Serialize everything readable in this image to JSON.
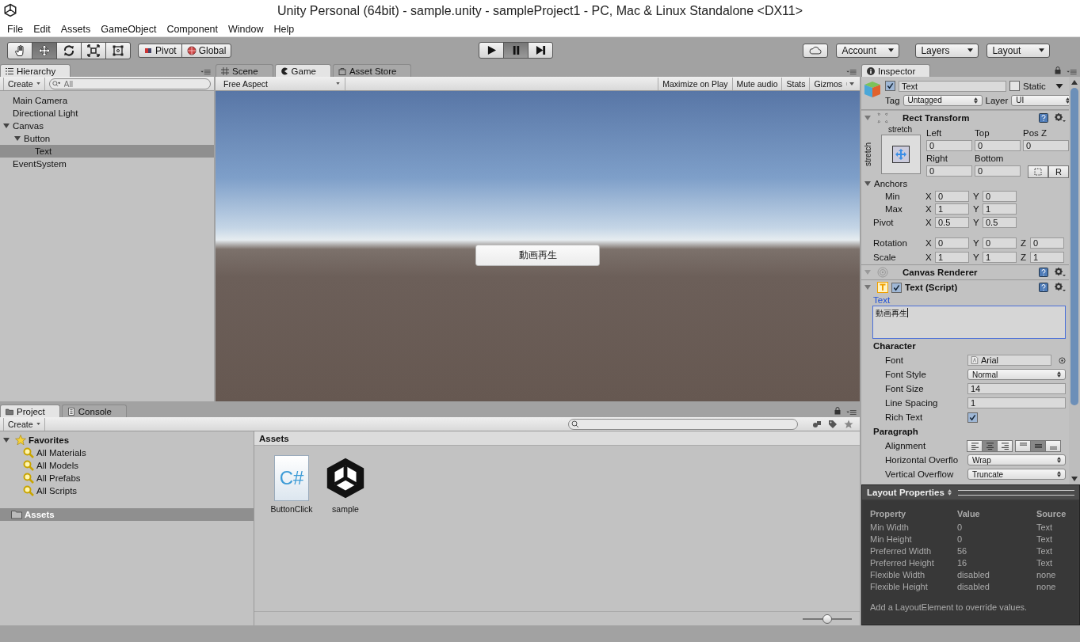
{
  "window": {
    "title": "Unity Personal (64bit) - sample.unity - sampleProject1 - PC, Mac & Linux Standalone <DX11>"
  },
  "menu": [
    "File",
    "Edit",
    "Assets",
    "GameObject",
    "Component",
    "Window",
    "Help"
  ],
  "toolbar": {
    "tools": [
      {
        "kind": "hand",
        "selected": false
      },
      {
        "kind": "move",
        "selected": true
      },
      {
        "kind": "rotate",
        "selected": false
      },
      {
        "kind": "scale",
        "selected": false
      },
      {
        "kind": "rect",
        "selected": false
      }
    ],
    "pivot": "Pivot",
    "global": "Global",
    "playback": [
      {
        "kind": "play",
        "selected": false
      },
      {
        "kind": "pause",
        "selected": true
      },
      {
        "kind": "step",
        "selected": false
      }
    ],
    "account": "Account",
    "layers": "Layers",
    "layout": "Layout"
  },
  "hierarchy": {
    "tab": "Hierarchy",
    "create": "Create",
    "search": {
      "placeholder": "All"
    },
    "items": [
      {
        "label": "Main Camera",
        "selected": false
      },
      {
        "label": "Directional Light",
        "selected": false
      },
      {
        "label": "Canvas",
        "selected": false,
        "expanded": true,
        "children": [
          {
            "label": "Button",
            "selected": false,
            "expanded": true,
            "children": [
              {
                "label": "Text",
                "selected": true
              }
            ]
          }
        ]
      },
      {
        "label": "EventSystem",
        "selected": false
      }
    ]
  },
  "view": {
    "tabs": [
      {
        "kind": "scene",
        "label": "Scene",
        "selected": false
      },
      {
        "kind": "game",
        "label": "Game",
        "selected": true
      },
      {
        "kind": "store",
        "label": "Asset Store",
        "selected": false
      }
    ],
    "aspect": "Free Aspect",
    "options": [
      "Maximize on Play",
      "Mute audio",
      "Stats",
      "Gizmos"
    ],
    "game_button": "動画再生"
  },
  "project": {
    "tabs": [
      {
        "kind": "project",
        "label": "Project",
        "selected": true
      },
      {
        "kind": "console",
        "label": "Console",
        "selected": false
      }
    ],
    "create": "Create",
    "favorites": {
      "label": "Favorites",
      "expanded": true,
      "items": [
        "All Materials",
        "All Models",
        "All Prefabs",
        "All Scripts"
      ]
    },
    "folders": [
      {
        "label": "Assets",
        "selected": true
      }
    ],
    "breadcrumb": "Assets",
    "assets": [
      {
        "kind": "script",
        "name": "ButtonClick",
        "badge": "C#"
      },
      {
        "kind": "scene",
        "name": "sample"
      }
    ],
    "zoom": {
      "level": 0.5
    }
  },
  "inspector": {
    "tab": "Inspector",
    "object": {
      "active": true,
      "name": "Text",
      "static": false,
      "static_label": "Static",
      "tag_label": "Tag",
      "tag": "Untagged",
      "layer_label": "Layer",
      "layer": "UI"
    },
    "rect_transform": {
      "title": "Rect Transform",
      "preset_h": "stretch",
      "preset_v": "stretch",
      "fields": [
        {
          "label": "Left",
          "value": "0"
        },
        {
          "label": "Top",
          "value": "0"
        },
        {
          "label": "Pos Z",
          "value": "0"
        },
        {
          "label": "Right",
          "value": "0"
        },
        {
          "label": "Bottom",
          "value": "0"
        }
      ],
      "reset": "R",
      "anchors": {
        "label": "Anchors",
        "rows": [
          {
            "label": "Min",
            "components": [
              {
                "axis": "X",
                "value": "0"
              },
              {
                "axis": "Y",
                "value": "0"
              }
            ]
          },
          {
            "label": "Max",
            "components": [
              {
                "axis": "X",
                "value": "1"
              },
              {
                "axis": "Y",
                "value": "1"
              }
            ]
          }
        ]
      },
      "pivot": {
        "label": "Pivot",
        "components": [
          {
            "axis": "X",
            "value": "0.5"
          },
          {
            "axis": "Y",
            "value": "0.5"
          }
        ]
      },
      "vectors": [
        {
          "label": "Rotation",
          "components": [
            {
              "axis": "X",
              "value": "0"
            },
            {
              "axis": "Y",
              "value": "0"
            },
            {
              "axis": "Z",
              "value": "0"
            }
          ]
        },
        {
          "label": "Scale",
          "components": [
            {
              "axis": "X",
              "value": "1"
            },
            {
              "axis": "Y",
              "value": "1"
            },
            {
              "axis": "Z",
              "value": "1"
            }
          ]
        }
      ]
    },
    "canvas_renderer": {
      "title": "Canvas Renderer"
    },
    "text_component": {
      "title": "Text (Script)",
      "enabled": true,
      "text_label": "Text",
      "text_value": "動画再生",
      "rows": [
        {
          "kind": "heading",
          "label": "Character"
        },
        {
          "kind": "object",
          "label": "Font",
          "value": "Arial"
        },
        {
          "kind": "dropdown",
          "label": "Font Style",
          "value": "Normal"
        },
        {
          "kind": "field",
          "label": "Font Size",
          "value": "14"
        },
        {
          "kind": "field",
          "label": "Line Spacing",
          "value": "1"
        },
        {
          "kind": "checkbox",
          "label": "Rich Text",
          "checked": true
        },
        {
          "kind": "heading",
          "label": "Paragraph"
        },
        {
          "kind": "alignment",
          "label": "Alignment",
          "horizontal": [
            {
              "kind": "left",
              "selected": false
            },
            {
              "kind": "center",
              "selected": true
            },
            {
              "kind": "right",
              "selected": false
            }
          ],
          "vertical": [
            {
              "kind": "top",
              "selected": false
            },
            {
              "kind": "middle",
              "selected": true
            },
            {
              "kind": "bottom",
              "selected": false
            }
          ]
        },
        {
          "kind": "dropdown",
          "label": "Horizontal Overflo",
          "value": "Wrap"
        },
        {
          "kind": "dropdown",
          "label": "Vertical Overflow",
          "value": "Truncate"
        }
      ]
    }
  },
  "layout_properties": {
    "title": "Layout Properties",
    "columns": [
      "Property",
      "Value",
      "Source"
    ],
    "rows": [
      [
        "Min Width",
        "0",
        "Text"
      ],
      [
        "Min Height",
        "0",
        "Text"
      ],
      [
        "Preferred Width",
        "56",
        "Text"
      ],
      [
        "Preferred Height",
        "16",
        "Text"
      ],
      [
        "Flexible Width",
        "disabled",
        "none"
      ],
      [
        "Flexible Height",
        "disabled",
        "none"
      ]
    ],
    "note": "Add a LayoutElement to override values."
  }
}
